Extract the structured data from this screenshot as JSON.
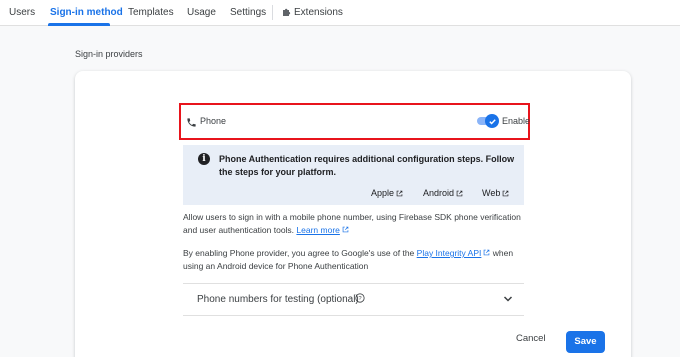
{
  "tabs": [
    {
      "label": "Users"
    },
    {
      "label": "Sign-in method"
    },
    {
      "label": "Templates"
    },
    {
      "label": "Usage"
    },
    {
      "label": "Settings"
    },
    {
      "label": "Extensions"
    }
  ],
  "section_title": "Sign-in providers",
  "provider": {
    "name": "Phone",
    "icon": "phone-icon",
    "enabled": true,
    "toggle_label": "Enable"
  },
  "info_box": {
    "icon": "info-icon",
    "text": "Phone Authentication requires additional configuration steps. Follow the steps for your platform.",
    "platforms": [
      "Apple",
      "Android",
      "Web"
    ]
  },
  "description": {
    "p1_text": "Allow users to sign in with a mobile phone number, using Firebase SDK phone verification and user authentication tools. ",
    "p1_link": "Learn more",
    "p2_before": "By enabling Phone provider, you agree to Google's use of the ",
    "p2_link": "Play Integrity API",
    "p2_after": " when using an Android device for Phone Authentication"
  },
  "testing": {
    "label": "Phone numbers for testing (optional)"
  },
  "actions": {
    "cancel": "Cancel",
    "save": "Save"
  },
  "colors": {
    "accent": "#1a73e8",
    "highlight_border": "#e8141c",
    "info_bg": "#e8eef7"
  }
}
